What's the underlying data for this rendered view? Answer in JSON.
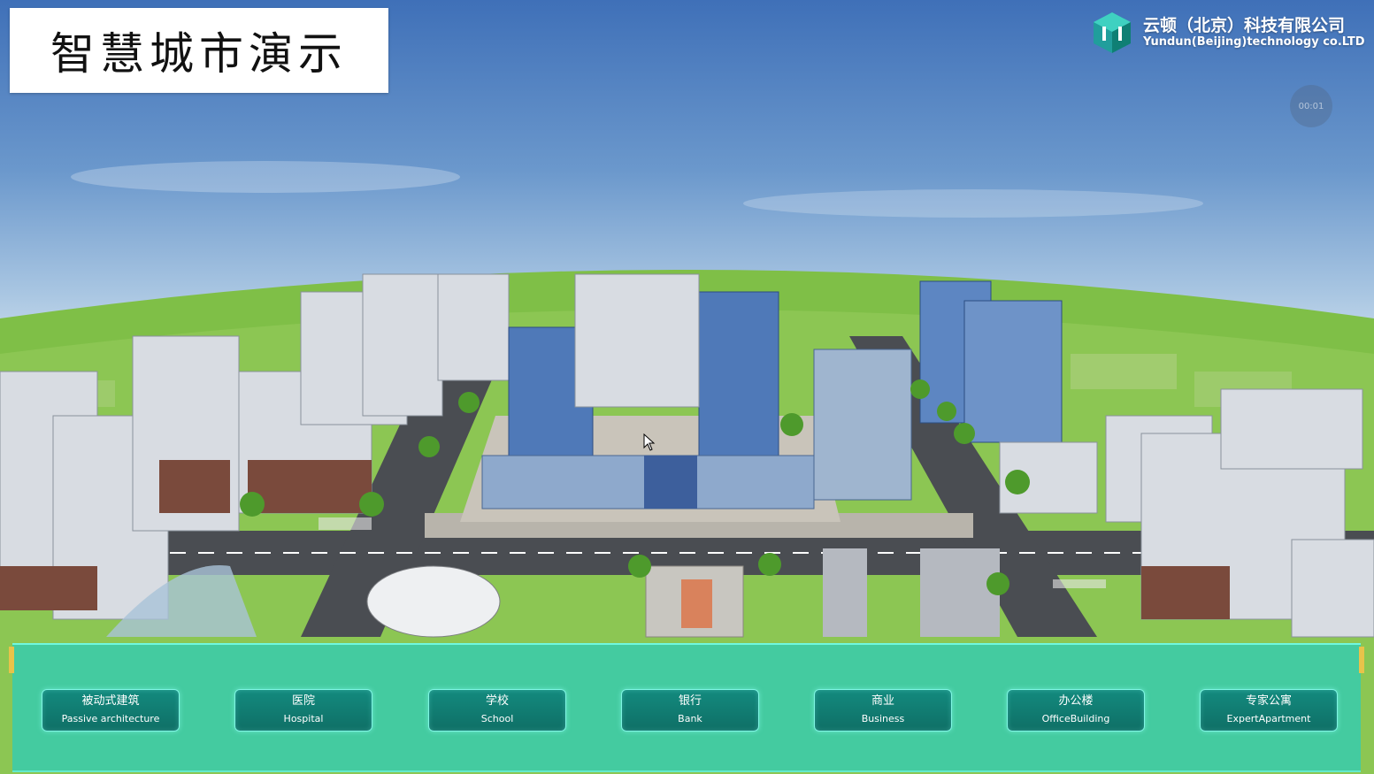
{
  "title": "智慧城市演示",
  "brand": {
    "name_cn": "云顿（北京）科技有限公司",
    "name_en": "Yundun(Beijing)technology co.LTD",
    "icon": "cube-logo-icon"
  },
  "timer": "00:01",
  "nav_buttons": [
    {
      "cn": "被动式建筑",
      "en": "Passive architecture"
    },
    {
      "cn": "医院",
      "en": "Hospital"
    },
    {
      "cn": "学校",
      "en": "School"
    },
    {
      "cn": "银行",
      "en": "Bank"
    },
    {
      "cn": "商业",
      "en": "Business"
    },
    {
      "cn": "办公楼",
      "en": "OfficeBuilding"
    },
    {
      "cn": "专家公寓",
      "en": "ExpertApartment"
    }
  ],
  "colors": {
    "panel": "#28cdbe",
    "button": "#0f6f66",
    "button_border": "#7ff5e3",
    "accent_gold": "#e8c34a"
  }
}
